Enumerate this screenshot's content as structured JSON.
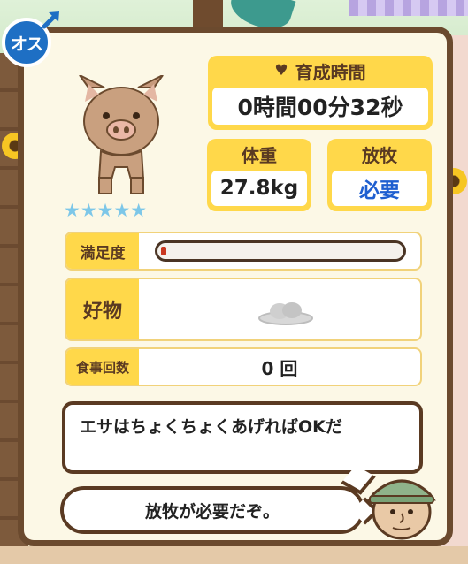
{
  "sex": {
    "label": "オス",
    "color": "#1e6fc4"
  },
  "rarity": {
    "stars": "★★★★★",
    "count": 5
  },
  "growth_time": {
    "label": "育成時間",
    "value": "0時間00分32秒",
    "icon": "heart-icon"
  },
  "weight": {
    "label": "体重",
    "value": "27.8kg"
  },
  "grazing": {
    "label": "放牧",
    "value": "必要",
    "value_color": "#1f5fd0"
  },
  "satisfaction": {
    "label": "満足度",
    "level": 0.02
  },
  "favorite": {
    "label": "好物",
    "icon": "food-dish-icon"
  },
  "meals": {
    "label": "食事回数",
    "value": "0 回"
  },
  "messages": {
    "tip": "エサはちょくちょくあげればOKだ",
    "notice": "放牧が必要だぞ。"
  },
  "colors": {
    "accent": "#ffd84a",
    "frame": "#6b4a2e",
    "panel": "#fcf8e6"
  }
}
